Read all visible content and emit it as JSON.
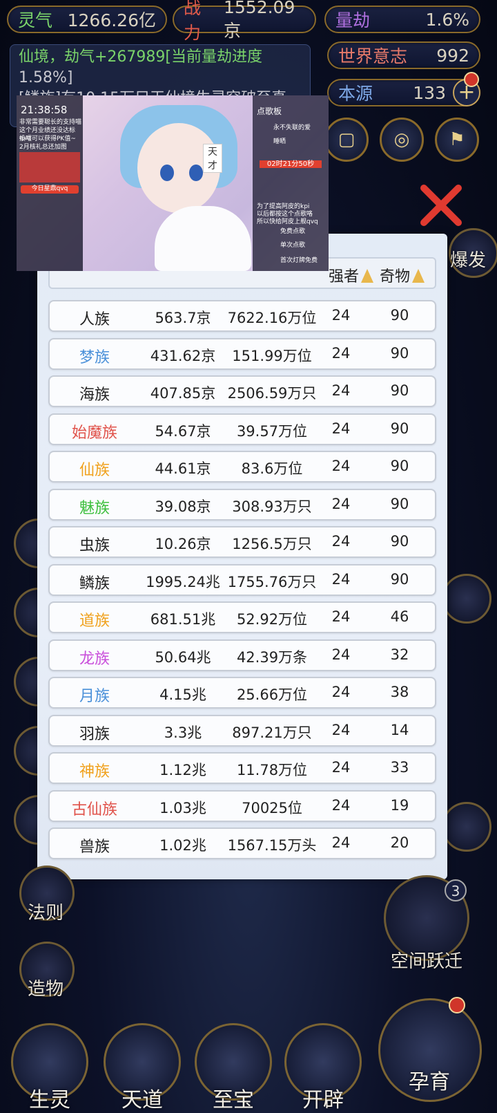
{
  "status": {
    "lingqi_label": "灵气",
    "lingqi_value": "1266.26亿",
    "zhanli_label": "战力",
    "zhanli_value": "1552.09京",
    "liangjie_label": "量劫",
    "liangjie_value": "1.6%",
    "world_will_label": "世界意志",
    "world_will_value": "992",
    "origin_label": "本源",
    "origin_value": "133"
  },
  "message": {
    "line1": "仙境，劫气+267989[当前量劫进度",
    "line2": "1.58%]",
    "line3": "[鳞族]有10.15万只天仙境生灵突破至真"
  },
  "overlay": {
    "time": "21:38:58",
    "desc1": "非常需要聪长的支持喵",
    "desc2": "这个月业绩还没达标qvq",
    "desc3": "投喂可以获得PK值~",
    "desc4": "2月核礼总还加图",
    "today_btn": "今日星鼎qvq",
    "song_board": "点歌板",
    "song1": "永不失联的爱",
    "song2": "睡晒",
    "countdown": "02时21分50秒",
    "tian": "天才",
    "promo1": "为了提高阿皮的kpi",
    "promo2": "以后都按这个点歌咯",
    "promo3": "所以快给阿皮上舰qvq",
    "free_song": "免费点歌",
    "single_song": "单次点歌",
    "first_free": "首次灯牌免费"
  },
  "right_side": {
    "burst_label": "爆发"
  },
  "table": {
    "headers": [
      "强者",
      "奇物"
    ],
    "rows": [
      {
        "name": "人族",
        "color": "#222222",
        "c1": "563.7京",
        "c2": "7622.16万位",
        "c3": "24",
        "c4": "90"
      },
      {
        "name": "梦族",
        "color": "#4a90d9",
        "c1": "431.62京",
        "c2": "151.99万位",
        "c3": "24",
        "c4": "90"
      },
      {
        "name": "海族",
        "color": "#222222",
        "c1": "407.85京",
        "c2": "2506.59万只",
        "c3": "24",
        "c4": "90"
      },
      {
        "name": "始魔族",
        "color": "#e0524a",
        "c1": "54.67京",
        "c2": "39.57万位",
        "c3": "24",
        "c4": "90"
      },
      {
        "name": "仙族",
        "color": "#f0a11c",
        "c1": "44.61京",
        "c2": "83.6万位",
        "c3": "24",
        "c4": "90"
      },
      {
        "name": "魅族",
        "color": "#3cbf3c",
        "c1": "39.08京",
        "c2": "308.93万只",
        "c3": "24",
        "c4": "90"
      },
      {
        "name": "虫族",
        "color": "#222222",
        "c1": "10.26京",
        "c2": "1256.5万只",
        "c3": "24",
        "c4": "90"
      },
      {
        "name": "鳞族",
        "color": "#222222",
        "c1": "1995.24兆",
        "c2": "1755.76万只",
        "c3": "24",
        "c4": "90"
      },
      {
        "name": "道族",
        "color": "#f0a11c",
        "c1": "681.51兆",
        "c2": "52.92万位",
        "c3": "24",
        "c4": "46"
      },
      {
        "name": "龙族",
        "color": "#c94fdb",
        "c1": "50.64兆",
        "c2": "42.39万条",
        "c3": "24",
        "c4": "32"
      },
      {
        "name": "月族",
        "color": "#4a90d9",
        "c1": "4.15兆",
        "c2": "25.66万位",
        "c3": "24",
        "c4": "38"
      },
      {
        "name": "羽族",
        "color": "#222222",
        "c1": "3.3兆",
        "c2": "897.21万只",
        "c3": "24",
        "c4": "14"
      },
      {
        "name": "神族",
        "color": "#f0a11c",
        "c1": "1.12兆",
        "c2": "11.78万位",
        "c3": "24",
        "c4": "33"
      },
      {
        "name": "古仙族",
        "color": "#e0524a",
        "c1": "1.03兆",
        "c2": "70025位",
        "c3": "24",
        "c4": "19"
      },
      {
        "name": "兽族",
        "color": "#222222",
        "c1": "1.02兆",
        "c2": "1567.15万头",
        "c3": "24",
        "c4": "20"
      }
    ]
  },
  "left_side": {
    "law_label": "法则",
    "create_label": "造物"
  },
  "space_jump_label": "空间跃迁",
  "space_jump_badge": "3",
  "bottom": {
    "shengling": "生灵",
    "tiandao": "天道",
    "zhibao": "至宝",
    "kaipi": "开辟",
    "yunyu": "孕育"
  }
}
